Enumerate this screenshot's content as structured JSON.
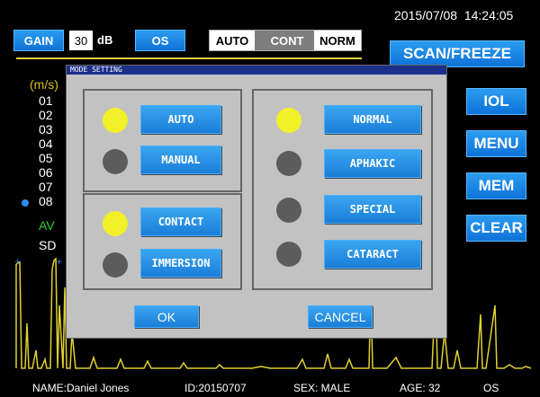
{
  "header": {
    "datetime": "2015/07/08  14:24:05",
    "gain_label": "GAIN",
    "gain_value": "30",
    "gain_unit": "dB",
    "eye_label": "OS",
    "modes": [
      "AUTO",
      "CONT",
      "NORM"
    ],
    "active_modes": [
      0,
      2
    ]
  },
  "side_buttons": {
    "scan_freeze": "SCAN/FREEZE",
    "iol": "IOL",
    "menu": "MENU",
    "mem": "MEM",
    "clear": "CLEAR"
  },
  "measurements": {
    "unit_label": "(m/s)",
    "items": [
      "01",
      "02",
      "03",
      "04",
      "05",
      "06",
      "07",
      "08"
    ],
    "selected": "08",
    "av_label": "AV",
    "sd_label": "SD"
  },
  "patient": {
    "name": "NAME:Daniel Jones",
    "id": "ID:20150707",
    "sex": "SEX: MALE",
    "age": "AGE: 32",
    "eye": "OS"
  },
  "dialog": {
    "title": "MODE SETTING",
    "measure_modes": [
      {
        "label": "AUTO",
        "selected": true
      },
      {
        "label": "MANUAL",
        "selected": false
      }
    ],
    "contact_modes": [
      {
        "label": "CONTACT",
        "selected": true
      },
      {
        "label": "IMMERSION",
        "selected": false
      }
    ],
    "eye_types": [
      {
        "label": "NORMAL",
        "selected": true
      },
      {
        "label": "APHAKIC",
        "selected": false
      },
      {
        "label": "SPECIAL",
        "selected": false
      },
      {
        "label": "CATARACT",
        "selected": false
      }
    ],
    "ok_label": "OK",
    "cancel_label": "CANCEL"
  },
  "colors": {
    "accent_blue": "#1a7ed8",
    "dialog_title_bg": "#1c2f8a",
    "radio_on": "#f2f028",
    "radio_off": "#5c5c5c",
    "waveform": "#e0d030",
    "av_label": "#2fd12f"
  }
}
